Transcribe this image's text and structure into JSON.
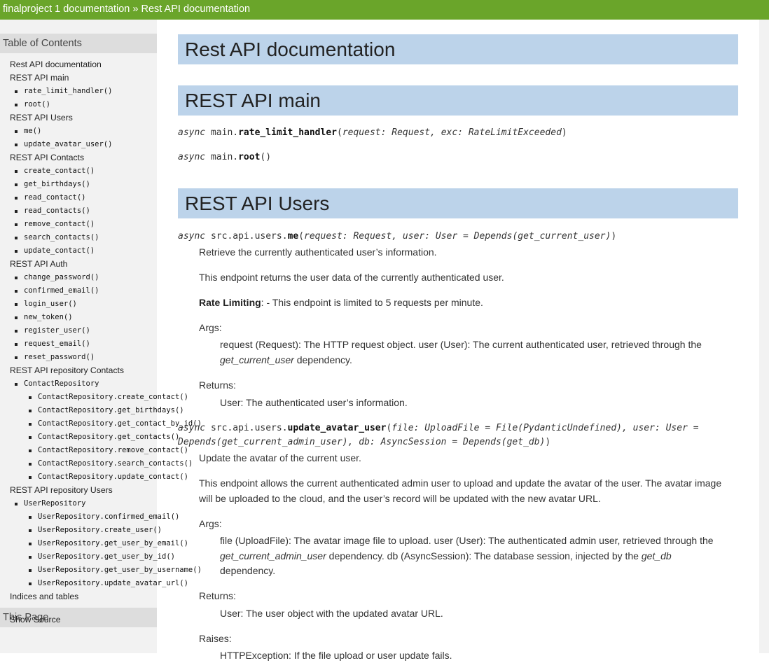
{
  "breadcrumb": {
    "project": "finalproject 1 documentation",
    "separator": "»",
    "current": "Rest API documentation"
  },
  "sidebar": {
    "toc_heading": "Table of Contents",
    "this_page_heading": "This Page",
    "show_source": "Show Source",
    "items": [
      {
        "level": 0,
        "label": "Rest API documentation"
      },
      {
        "level": 0,
        "label": "REST API main"
      },
      {
        "level": 1,
        "label": "rate_limit_handler()"
      },
      {
        "level": 1,
        "label": "root()"
      },
      {
        "level": 0,
        "label": "REST API Users"
      },
      {
        "level": 1,
        "label": "me()"
      },
      {
        "level": 1,
        "label": "update_avatar_user()"
      },
      {
        "level": 0,
        "label": "REST API Contacts"
      },
      {
        "level": 1,
        "label": "create_contact()"
      },
      {
        "level": 1,
        "label": "get_birthdays()"
      },
      {
        "level": 1,
        "label": "read_contact()"
      },
      {
        "level": 1,
        "label": "read_contacts()"
      },
      {
        "level": 1,
        "label": "remove_contact()"
      },
      {
        "level": 1,
        "label": "search_contacts()"
      },
      {
        "level": 1,
        "label": "update_contact()"
      },
      {
        "level": 0,
        "label": "REST API Auth"
      },
      {
        "level": 1,
        "label": "change_password()"
      },
      {
        "level": 1,
        "label": "confirmed_email()"
      },
      {
        "level": 1,
        "label": "login_user()"
      },
      {
        "level": 1,
        "label": "new_token()"
      },
      {
        "level": 1,
        "label": "register_user()"
      },
      {
        "level": 1,
        "label": "request_email()"
      },
      {
        "level": 1,
        "label": "reset_password()"
      },
      {
        "level": 0,
        "label": "REST API repository Contacts"
      },
      {
        "level": 1,
        "label": "ContactRepository"
      },
      {
        "level": 2,
        "label": "ContactRepository.create_contact()"
      },
      {
        "level": 2,
        "label": "ContactRepository.get_birthdays()"
      },
      {
        "level": 2,
        "label": "ContactRepository.get_contact_by_id()"
      },
      {
        "level": 2,
        "label": "ContactRepository.get_contacts()"
      },
      {
        "level": 2,
        "label": "ContactRepository.remove_contact()"
      },
      {
        "level": 2,
        "label": "ContactRepository.search_contacts()"
      },
      {
        "level": 2,
        "label": "ContactRepository.update_contact()"
      },
      {
        "level": 0,
        "label": "REST API repository Users"
      },
      {
        "level": 1,
        "label": "UserRepository"
      },
      {
        "level": 2,
        "label": "UserRepository.confirmed_email()"
      },
      {
        "level": 2,
        "label": "UserRepository.create_user()"
      },
      {
        "level": 2,
        "label": "UserRepository.get_user_by_email()"
      },
      {
        "level": 2,
        "label": "UserRepository.get_user_by_id()"
      },
      {
        "level": 2,
        "label": "UserRepository.get_user_by_username()"
      },
      {
        "level": 2,
        "label": "UserRepository.update_avatar_url()"
      },
      {
        "level": 0,
        "label": "Indices and tables"
      }
    ]
  },
  "content": {
    "h1": "Rest API documentation",
    "main": {
      "heading": "REST API main",
      "rate_limit_sig": {
        "prefix": "async",
        "module": "main.",
        "name": "rate_limit_handler",
        "params": "request: Request, exc: RateLimitExceeded"
      },
      "root_sig": {
        "prefix": "async",
        "module": "main.",
        "name": "root"
      }
    },
    "users": {
      "heading": "REST API Users",
      "me": {
        "prefix": "async",
        "module": "src.api.users.",
        "name": "me",
        "params": "request: Request, user: User = Depends(get_current_user)",
        "summary": "Retrieve the currently authenticated user’s information.",
        "description": "This endpoint returns the user data of the currently authenticated user.",
        "rate_label": "Rate Limiting",
        "rate_text": ": - This endpoint is limited to 5 requests per minute.",
        "args_label": "Args:",
        "args_text": "request (Request): The HTTP request object. user (User): The current authenticated user, retrieved through the",
        "args_em": "get_current_user",
        "args_tail": "dependency.",
        "returns_label": "Returns:",
        "returns_text": "User: The authenticated user’s information."
      },
      "update_avatar": {
        "prefix": "async",
        "module": "src.api.users.",
        "name": "update_avatar_user",
        "params_line1": "file: UploadFile = File(PydanticUndefined), user: User =",
        "params_line2": "Depends(get_current_admin_user), db: AsyncSession = Depends(get_db)",
        "summary": "Update the avatar of the current user.",
        "description_line1": "This endpoint allows the current authenticated admin user to upload and update the avatar of the user. The avatar image",
        "description_line2": "will be uploaded to the cloud, and the user’s record will be updated with the new avatar URL.",
        "args_label": "Args:",
        "args_line1": "file (UploadFile): The avatar image file to upload. user (User): The authenticated admin user, retrieved through the",
        "args_em1": "get_current_admin_user",
        "args_mid": "dependency. db (AsyncSession): The database session, injected by the",
        "args_em2": "get_db",
        "args_line3": "dependency.",
        "returns_label": "Returns:",
        "returns_text": "User: The user object with the updated avatar URL.",
        "raises_label": "Raises:",
        "raises_text": "HTTPException: If the file upload or user update fails."
      }
    }
  }
}
